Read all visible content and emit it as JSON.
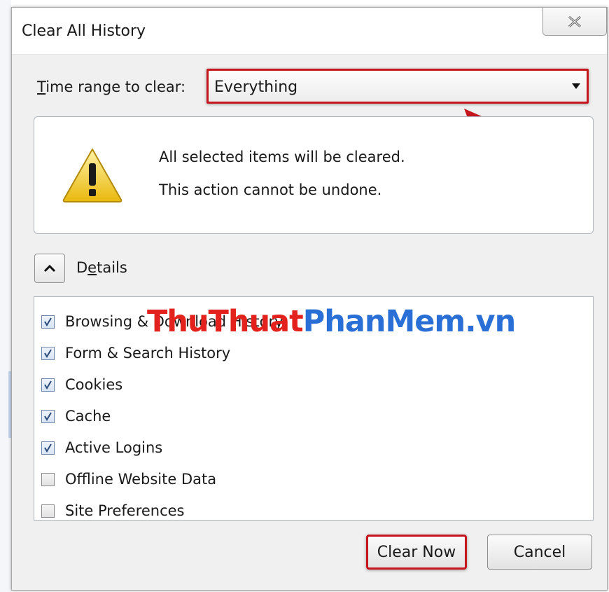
{
  "window": {
    "title": "Clear All History",
    "close_icon": "close-icon"
  },
  "time_range": {
    "label_underlined": "T",
    "label_rest": "ime range to clear:",
    "value": "Everything"
  },
  "warning": {
    "icon": "warning-icon",
    "line1": "All selected items will be cleared.",
    "line2": "This action cannot be undone."
  },
  "details": {
    "label_prefix": "D",
    "label_underlined": "e",
    "label_rest": "tails",
    "toggle_icon": "chevron-up-icon"
  },
  "items": [
    {
      "label": "Browsing & Download History",
      "checked": true
    },
    {
      "label": "Form & Search History",
      "checked": true
    },
    {
      "label": "Cookies",
      "checked": true
    },
    {
      "label": "Cache",
      "checked": true
    },
    {
      "label": "Active Logins",
      "checked": true
    },
    {
      "label": "Offline Website Data",
      "checked": false
    },
    {
      "label": "Site Preferences",
      "checked": false
    }
  ],
  "watermark": {
    "part1": "ThuThuat",
    "part2": "PhanMem.vn"
  },
  "buttons": {
    "clear_now": "Clear Now",
    "cancel": "Cancel"
  },
  "colors": {
    "highlight": "#c4161c",
    "watermark_red": "#e3211d",
    "watermark_blue": "#2a6fd6"
  }
}
